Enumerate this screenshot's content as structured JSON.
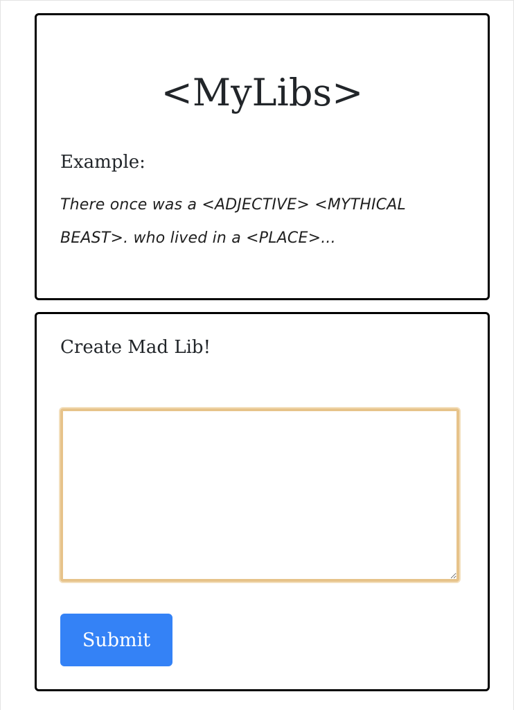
{
  "header": {
    "title": "<MyLibs>"
  },
  "example": {
    "heading": "Example:",
    "text": "There once was a <ADJECTIVE> <MYTHICAL BEAST>. who lived in a <PLACE>..."
  },
  "create": {
    "heading": "Create Mad Lib!",
    "textarea_value": "",
    "submit_label": "Submit"
  },
  "colors": {
    "card_border": "#000000",
    "textarea_focus_border": "#e7c38a",
    "submit_background": "#3482f6",
    "submit_text": "#ffffff"
  }
}
